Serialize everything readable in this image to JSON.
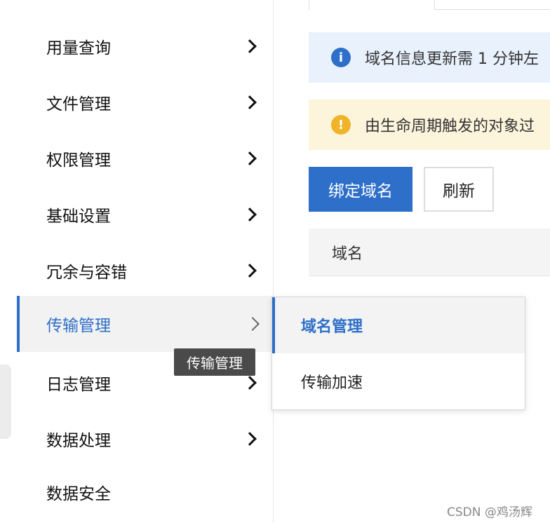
{
  "sidebar": {
    "items": [
      {
        "label": "用量查询"
      },
      {
        "label": "文件管理"
      },
      {
        "label": "权限管理"
      },
      {
        "label": "基础设置"
      },
      {
        "label": "冗余与容错"
      },
      {
        "label": "传输管理",
        "active": true
      },
      {
        "label": "日志管理"
      },
      {
        "label": "数据处理"
      },
      {
        "label": "数据安全"
      }
    ]
  },
  "tooltip": {
    "text": "传输管理"
  },
  "submenu": {
    "items": [
      {
        "label": "域名管理",
        "active": true
      },
      {
        "label": "传输加速"
      }
    ]
  },
  "alerts": {
    "info": {
      "text": "域名信息更新需 1 分钟左",
      "icon": "info-icon"
    },
    "warning": {
      "text": "由生命周期触发的对象过",
      "icon": "warning-icon"
    }
  },
  "toolbar": {
    "bind_domain_label": "绑定域名",
    "refresh_label": "刷新"
  },
  "table": {
    "columns": [
      "域名"
    ]
  },
  "watermark": "CSDN @鸡汤辉",
  "colors": {
    "accent": "#2d6fc9",
    "info_bg": "#e8f1fc",
    "warning_bg": "#fdf4dc",
    "warning_icon": "#f0b429"
  }
}
